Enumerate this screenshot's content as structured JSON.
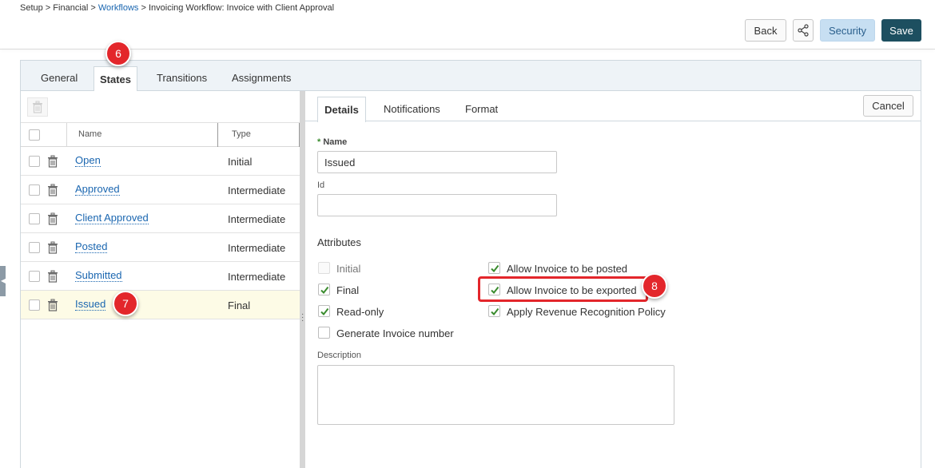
{
  "breadcrumb": {
    "setup": "Setup",
    "sep1": " > ",
    "financial": "Financial",
    "sep2": " > ",
    "workflows": "Workflows",
    "sep3": " > ",
    "current": "Invoicing Workflow: Invoice with Client Approval"
  },
  "toolbar": {
    "back_label": "Back",
    "share_icon": "share-icon",
    "security_label": "Security",
    "save_label": "Save"
  },
  "main_tabs": [
    {
      "label": "General"
    },
    {
      "label": "States",
      "active": true
    },
    {
      "label": "Transitions"
    },
    {
      "label": "Assignments"
    }
  ],
  "states_grid": {
    "columns": {
      "name": "Name",
      "type": "Type"
    },
    "rows": [
      {
        "name": "Open",
        "type": "Initial"
      },
      {
        "name": "Approved",
        "type": "Intermediate"
      },
      {
        "name": "Client Approved",
        "type": "Intermediate"
      },
      {
        "name": "Posted",
        "type": "Intermediate"
      },
      {
        "name": "Submitted",
        "type": "Intermediate"
      },
      {
        "name": "Issued",
        "type": "Final",
        "selected": true
      }
    ]
  },
  "detail_tabs": [
    {
      "label": "Details",
      "active": true
    },
    {
      "label": "Notifications"
    },
    {
      "label": "Format"
    }
  ],
  "cancel_label": "Cancel",
  "form": {
    "required_marker": "*",
    "name_label": "Name",
    "name_value": "Issued",
    "id_label": "Id",
    "id_value": "",
    "attributes_label": "Attributes",
    "attributes_left": [
      {
        "label": "Initial",
        "checked": false,
        "disabled": true
      },
      {
        "label": "Final",
        "checked": true,
        "disabled": false
      },
      {
        "label": "Read-only",
        "checked": true,
        "disabled": false
      },
      {
        "label": "Generate Invoice number",
        "checked": false,
        "disabled": false
      }
    ],
    "attributes_right": [
      {
        "label": "Allow Invoice to be posted",
        "checked": true
      },
      {
        "label": "Allow Invoice to be exported",
        "checked": true
      },
      {
        "label": "Apply Revenue Recognition Policy",
        "checked": true
      }
    ],
    "description_label": "Description",
    "description_value": ""
  },
  "callouts": {
    "states_tab": "6",
    "issued_row": "7",
    "export_checkbox": "8"
  },
  "colors": {
    "accent_link": "#1a66b0",
    "save_bg": "#1d4f60",
    "security_bg": "#c7dff2",
    "callout_red": "#e3262b",
    "check_green": "#3a8c2e"
  }
}
